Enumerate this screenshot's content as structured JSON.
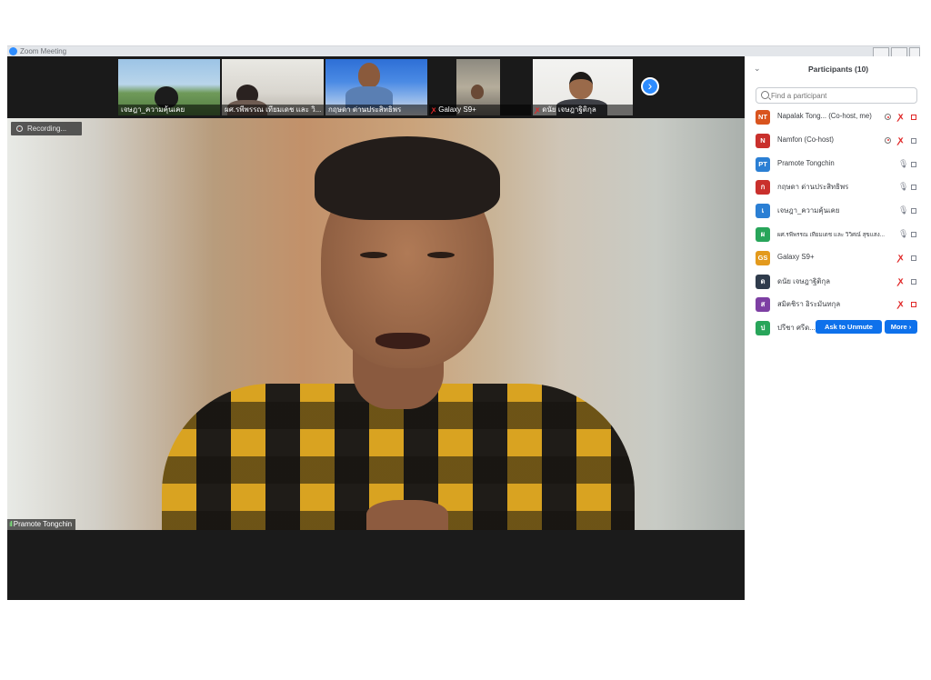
{
  "window": {
    "title": "Zoom Meeting"
  },
  "gallery": [
    {
      "name": "เจษฎา_ความคุ้นเคย",
      "muted": false
    },
    {
      "name": "ผศ.รพีพรรณ เทียมเดช และ วิ...",
      "muted": false
    },
    {
      "name": "กฤษดา ด่านประสิทธิพร",
      "muted": false
    },
    {
      "name": "Galaxy S9+",
      "muted": true
    },
    {
      "name": "ดนัย เจษฎาฐิติกุล",
      "muted": true
    }
  ],
  "next_page_icon": "chevron-right-icon",
  "recording_label": "Recording...",
  "active_speaker": "Pramote Tongchin",
  "participants_panel": {
    "title": "Participants (10)",
    "search_placeholder": "Find a participant",
    "participants": [
      {
        "initials": "NT",
        "color": "#d9541e",
        "name": "Napalak Tong... (Co-host, me)",
        "recording": true,
        "mic": "muted",
        "cam": "off"
      },
      {
        "initials": "N",
        "color": "#c9302c",
        "name": "Namfon (Co-host)",
        "recording": true,
        "mic": "muted",
        "cam": "on"
      },
      {
        "initials": "PT",
        "color": "#2b7fd4",
        "name": "Pramote Tongchin",
        "recording": false,
        "mic": "on",
        "cam": "on"
      },
      {
        "initials": "ก",
        "color": "#c9302c",
        "name": "กฤษดา ด่านประสิทธิพร",
        "recording": false,
        "mic": "on",
        "cam": "on"
      },
      {
        "initials": "เ",
        "color": "#2b7fd4",
        "name": "เจษฎา_ความคุ้นเคย",
        "recording": false,
        "mic": "on",
        "cam": "on"
      },
      {
        "initials": "ผ",
        "color": "#28a55a",
        "name": "ผศ.รพีพรรณ เทียมเดช และ วิวิศณ์ สุขแสง...",
        "recording": false,
        "mic": "on",
        "cam": "on"
      },
      {
        "initials": "GS",
        "color": "#e39a1d",
        "name": "Galaxy S9+",
        "recording": false,
        "mic": "muted",
        "cam": "on"
      },
      {
        "initials": "ด",
        "color": "#2f3b4c",
        "name": "ดนัย เจษฎาฐิติกุล",
        "recording": false,
        "mic": "muted",
        "cam": "on"
      },
      {
        "initials": "ส",
        "color": "#7d3fa3",
        "name": "สมิตชิรา อิระมันทกุล",
        "recording": false,
        "mic": "muted",
        "cam": "off"
      },
      {
        "initials": "ป",
        "color": "#28a55a",
        "name": "ปรีชา ศรีด...",
        "recording": false,
        "mic": "none",
        "cam": "none"
      }
    ],
    "ask_to_unmute_label": "Ask to Unmute",
    "more_label": "More ›"
  }
}
